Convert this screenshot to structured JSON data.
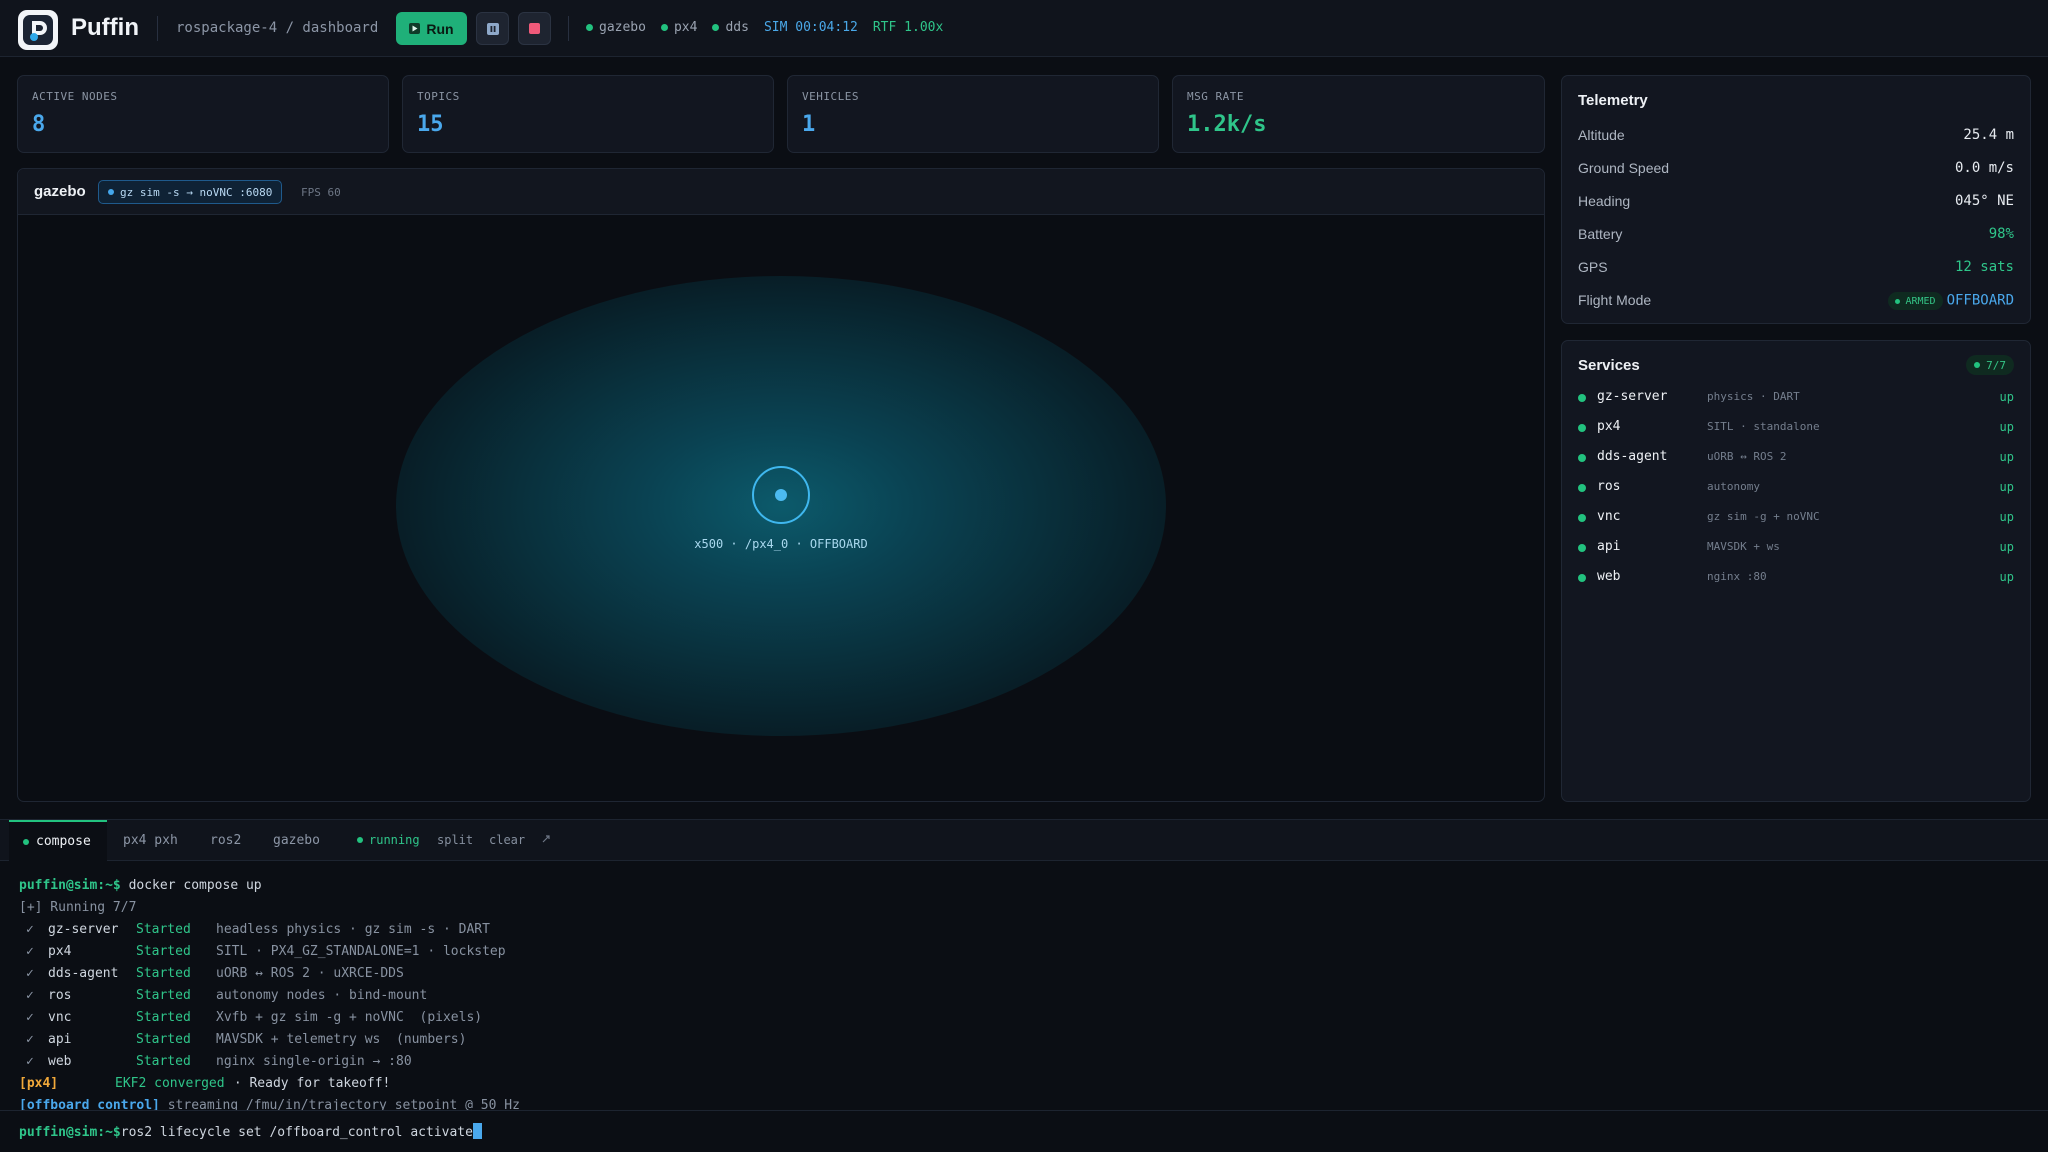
{
  "app": {
    "name": "Puffin",
    "breadcrumb": "rospackage-4 / dashboard"
  },
  "toolbar": {
    "run_label": "Run",
    "pause_icon": "pause-icon",
    "stop_icon": "stop-icon",
    "status": [
      {
        "label": "gazebo",
        "color": "#22c27f"
      },
      {
        "label": "px4",
        "color": "#22c27f"
      },
      {
        "label": "dds",
        "color": "#22c27f"
      }
    ],
    "sim_clock": "SIM 00:04:12",
    "rtf": "RTF 1.00x"
  },
  "stats": [
    {
      "label": "ACTIVE NODES",
      "value": "8"
    },
    {
      "label": "TOPICS",
      "value": "15"
    },
    {
      "label": "VEHICLES",
      "value": "1"
    },
    {
      "label": "MSG RATE",
      "value": "1.2k/s"
    }
  ],
  "viewport": {
    "title": "gazebo",
    "chip": "gz sim -s → noVNC :6080",
    "fps": "FPS 60",
    "vehicle_label": "x500 · /px4_0 · OFFBOARD"
  },
  "telemetry": {
    "title": "Telemetry",
    "rows": [
      {
        "label": "Altitude",
        "value": "25.4 m"
      },
      {
        "label": "Ground Speed",
        "value": "0.0 m/s"
      },
      {
        "label": "Heading",
        "value": "045° NE"
      },
      {
        "label": "Battery",
        "value": "98%"
      },
      {
        "label": "GPS",
        "value": "12 sats"
      },
      {
        "label": "Flight Mode",
        "badge": "ARMED",
        "value": "OFFBOARD"
      }
    ]
  },
  "services": {
    "title": "Services",
    "badge": "7/7",
    "items": [
      {
        "name": "gz-server",
        "desc": "physics · DART",
        "state": "up"
      },
      {
        "name": "px4",
        "desc": "SITL · standalone",
        "state": "up"
      },
      {
        "name": "dds-agent",
        "desc": "uORB ↔ ROS 2",
        "state": "up"
      },
      {
        "name": "ros",
        "desc": "autonomy",
        "state": "up"
      },
      {
        "name": "vnc",
        "desc": "gz sim -g + noVNC",
        "state": "up"
      },
      {
        "name": "api",
        "desc": "MAVSDK + ws",
        "state": "up"
      },
      {
        "name": "web",
        "desc": "nginx :80",
        "state": "up"
      }
    ]
  },
  "terminal": {
    "tabs": [
      "compose",
      "px4 pxh",
      "ros2",
      "gazebo"
    ],
    "running": "running",
    "split": "split",
    "clear": "clear",
    "expand_icon": "expand-icon",
    "prompt": "puffin@sim:~$",
    "command": "docker compose up",
    "running_line": "[+] Running 7/7",
    "check": "✓",
    "services": [
      {
        "name": "gz-server",
        "status": "Started",
        "desc": "headless physics · gz sim -s · DART"
      },
      {
        "name": "px4",
        "status": "Started",
        "desc": "SITL · PX4_GZ_STANDALONE=1 · lockstep"
      },
      {
        "name": "dds-agent",
        "status": "Started",
        "desc": "uORB ↔ ROS 2 · uXRCE-DDS"
      },
      {
        "name": "ros",
        "status": "Started",
        "desc": "autonomy nodes · bind-mount"
      },
      {
        "name": "vnc",
        "status": "Started",
        "desc": "Xvfb + gz sim -g + noVNC  (pixels)"
      },
      {
        "name": "api",
        "status": "Started",
        "desc": "MAVSDK + telemetry ws  (numbers)"
      },
      {
        "name": "web",
        "status": "Started",
        "desc": "nginx single-origin → :80"
      }
    ],
    "px4_tag": "[px4]",
    "px4_ekf": "EKF2 converged",
    "px4_msg": " · Ready for takeoff!",
    "off_tag": "[offboard_control]",
    "off_msg": "streaming /fmu/in/trajectory_setpoint @ 50 Hz",
    "input_prompt": "puffin@sim:~$",
    "input_command": "ros2 lifecycle set /offboard_control activate"
  }
}
